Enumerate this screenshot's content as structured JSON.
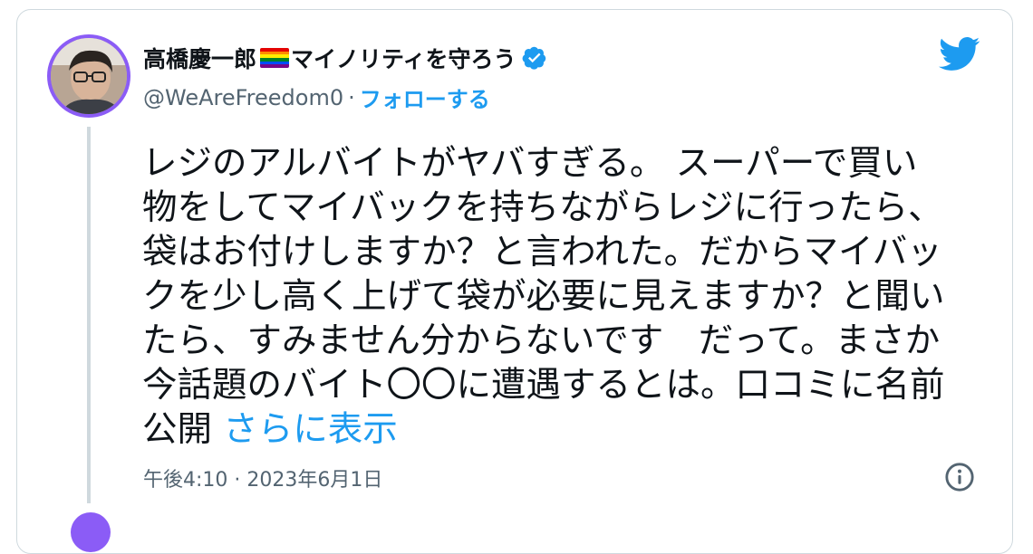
{
  "author": {
    "display_name_prefix": "高橋慶一郎",
    "display_name_suffix": "マイノリティを守ろう",
    "handle": "@WeAreFreedom0",
    "separator": "·",
    "follow_label": "フォローする",
    "verified_icon": "verified-badge-icon",
    "flag_icon": "rainbow-flag-icon"
  },
  "tweet": {
    "text": "レジのアルバイトがヤバすぎる。 スーパーで買い\n物をしてマイバックを持ちながらレジに行ったら、\n袋はお付けしますか？と言われた。だからマイバッ\nクを少し高く上げて袋が必要に見えますか？と聞い\nたら、すみません分からないです　だって。まさか\n今話題のバイト〇〇に遭遇するとは。口コミに名前\n公開 ",
    "show_more": "さらに表示",
    "timestamp": "午後4:10 · 2023年6月1日"
  },
  "colors": {
    "accent": "#1d9bf0",
    "secondary_text": "#536471",
    "avatar_ring": "#8b5cf6"
  },
  "icons": {
    "brand": "twitter-bird-icon",
    "info": "info-icon"
  }
}
